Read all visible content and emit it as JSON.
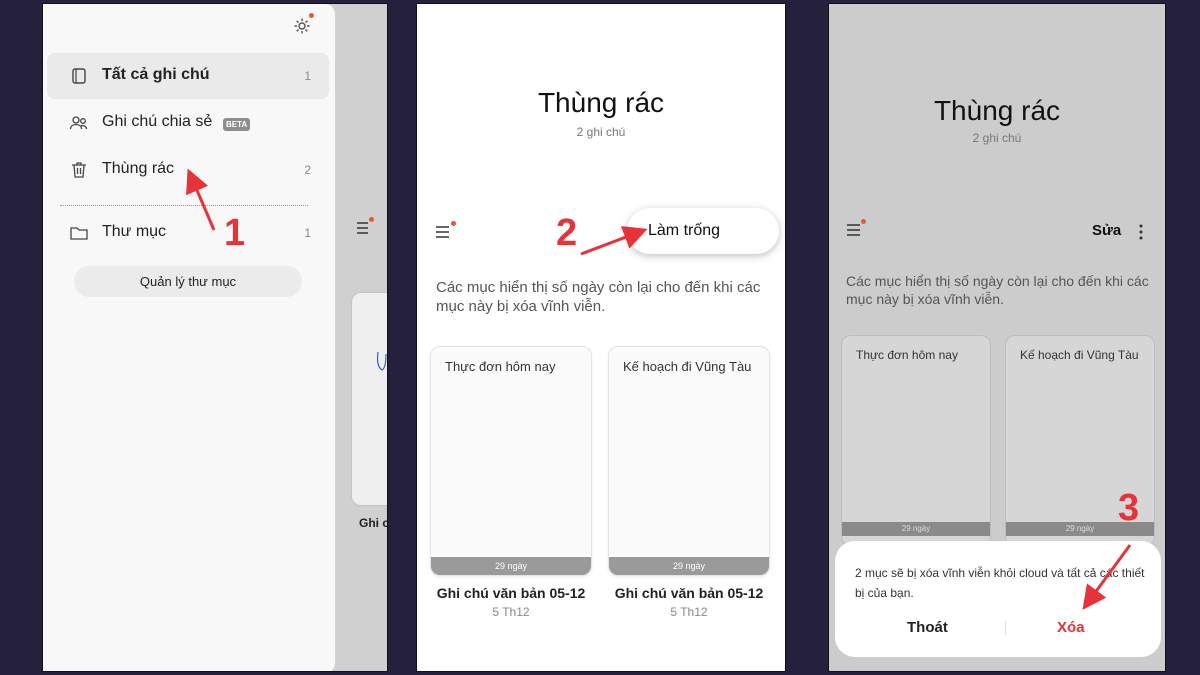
{
  "colors": {
    "background": "#25213c",
    "accent_dot": "#ee5a1e",
    "annotation": "#e8323a",
    "delete_text": "#e8323a"
  },
  "screen1": {
    "menu": [
      {
        "icon": "notebook-icon",
        "label": "Tất cả ghi chú",
        "count": "1"
      },
      {
        "icon": "people-icon",
        "label": "Ghi chú chia sẻ",
        "badge": "BETA"
      },
      {
        "icon": "trash-icon",
        "label": "Thùng rác",
        "count": "2"
      },
      {
        "icon": "folder-icon",
        "label": "Thư mục",
        "count": "1"
      }
    ],
    "manage_folders": "Quản lý thư mục",
    "peek_label": "Ghi c"
  },
  "screen2": {
    "title": "Thùng rác",
    "subtitle": "2 ghi chú",
    "empty_button": "Làm trống",
    "info": "Các mục hiển thị số ngày còn lại cho đến khi các mục này bị xóa vĩnh viễn.",
    "notes": [
      {
        "title": "Thực đơn hôm nay",
        "days": "29 ngày",
        "name": "Ghi chú văn bản 05-12",
        "date": "5 Th12"
      },
      {
        "title": "Kế hoạch đi Vũng Tàu",
        "days": "29 ngày",
        "name": "Ghi chú văn bản 05-12",
        "date": "5 Th12"
      }
    ]
  },
  "screen3": {
    "title": "Thùng rác",
    "subtitle": "2 ghi chú",
    "edit": "Sửa",
    "info": "Các mục hiển thị số ngày còn lại cho đến khi các mục này bị xóa vĩnh viễn.",
    "notes": [
      {
        "title": "Thực đơn hôm nay",
        "days": "29 ngày"
      },
      {
        "title": "Kế hoạch đi Vũng Tàu",
        "days": "29 ngày"
      }
    ],
    "dialog": {
      "message": "2 mục sẽ bị xóa vĩnh viễn khỏi cloud và tất cả các thiết bị của bạn.",
      "cancel": "Thoát",
      "delete": "Xóa"
    }
  },
  "annotations": {
    "step1": "1",
    "step2": "2",
    "step3": "3"
  }
}
